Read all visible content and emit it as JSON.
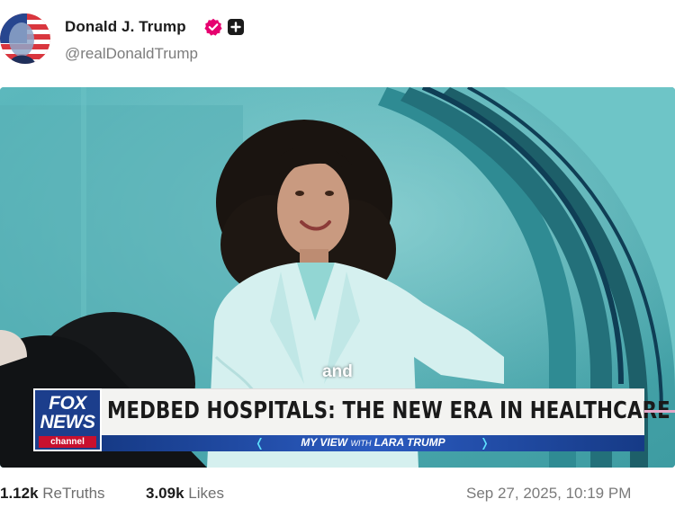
{
  "post": {
    "author": {
      "display_name": "Donald J. Trump",
      "handle": "@realDonaldTrump",
      "avatar_icon": "flag-portrait-avatar",
      "verified_icon": "verified-badge-icon",
      "badge_icon": "plus-badge-icon"
    },
    "media": {
      "type": "video",
      "caption": "and",
      "network_logo": {
        "line1": "FOX",
        "line2": "NEWS",
        "line3": "channel"
      },
      "headline": "MEDBED HOSPITALS: THE NEW ERA IN HEALTHCARE",
      "strap": {
        "show": "MY VIEW",
        "with": "WITH",
        "host": "LARA TRUMP"
      }
    },
    "stats": {
      "retruths_count": "1.12k",
      "retruths_label": "ReTruths",
      "likes_count": "3.09k",
      "likes_label": "Likes"
    },
    "timestamp": "Sep 27, 2025, 10:19 PM"
  },
  "colors": {
    "verified": "#e6006f",
    "fox_blue": "#1c3e8c",
    "fox_red": "#c8102e",
    "scene_teal": "#4da9ae"
  }
}
